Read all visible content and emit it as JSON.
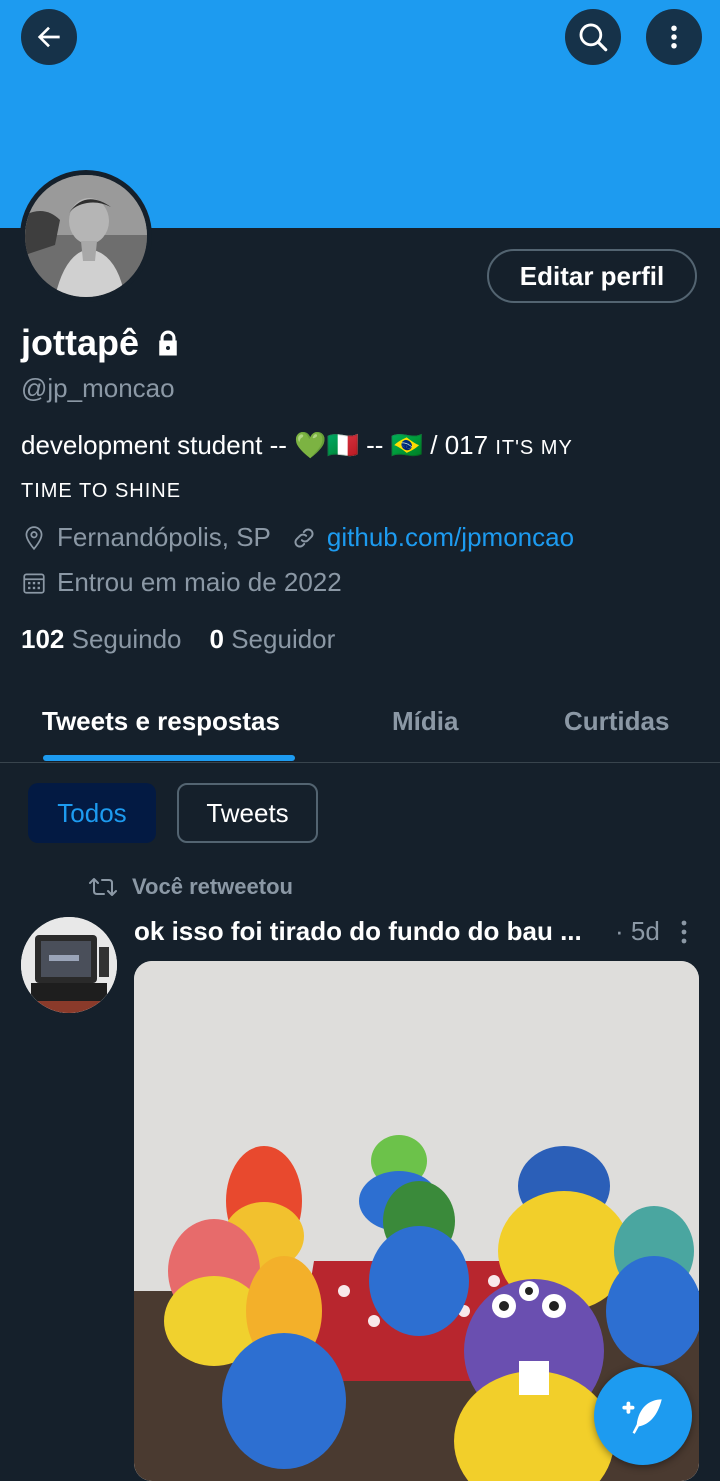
{
  "header": {
    "banner_color": "#1d9bf0",
    "back_icon": "arrow-left-icon",
    "search_icon": "search-icon",
    "more_icon": "more-vertical-icon"
  },
  "profile": {
    "edit_button": "Editar perfil",
    "name": "jottapê",
    "lock_icon": "lock-icon",
    "handle": "@jp_moncao",
    "bio_line1": "development student -- 💚🇮🇹 -- 🇧🇷 / 017 ",
    "bio_smallcaps1": "IT'S MY",
    "bio_smallcaps2": "TIME TO SHINE",
    "location": "Fernandópolis, SP",
    "website": "github.com/jpmoncao",
    "joined": "Entrou em maio de 2022",
    "following_count": "102",
    "following_label": "Seguindo",
    "followers_count": "0",
    "followers_label": "Seguidor"
  },
  "tabs": [
    {
      "label": "Tweets e respostas",
      "active": true
    },
    {
      "label": "Mídia",
      "active": false
    },
    {
      "label": "Curtidas",
      "active": false
    }
  ],
  "filters": [
    {
      "label": "Todos",
      "selected": true
    },
    {
      "label": "Tweets",
      "selected": false
    }
  ],
  "tweet": {
    "retweet_label": "Você retweetou",
    "text": "ok isso foi tirado do fundo do bau ...",
    "time": "· 5d"
  },
  "colors": {
    "background": "#15202b",
    "accent": "#1d9bf0",
    "secondary_text": "#8b98a5"
  }
}
